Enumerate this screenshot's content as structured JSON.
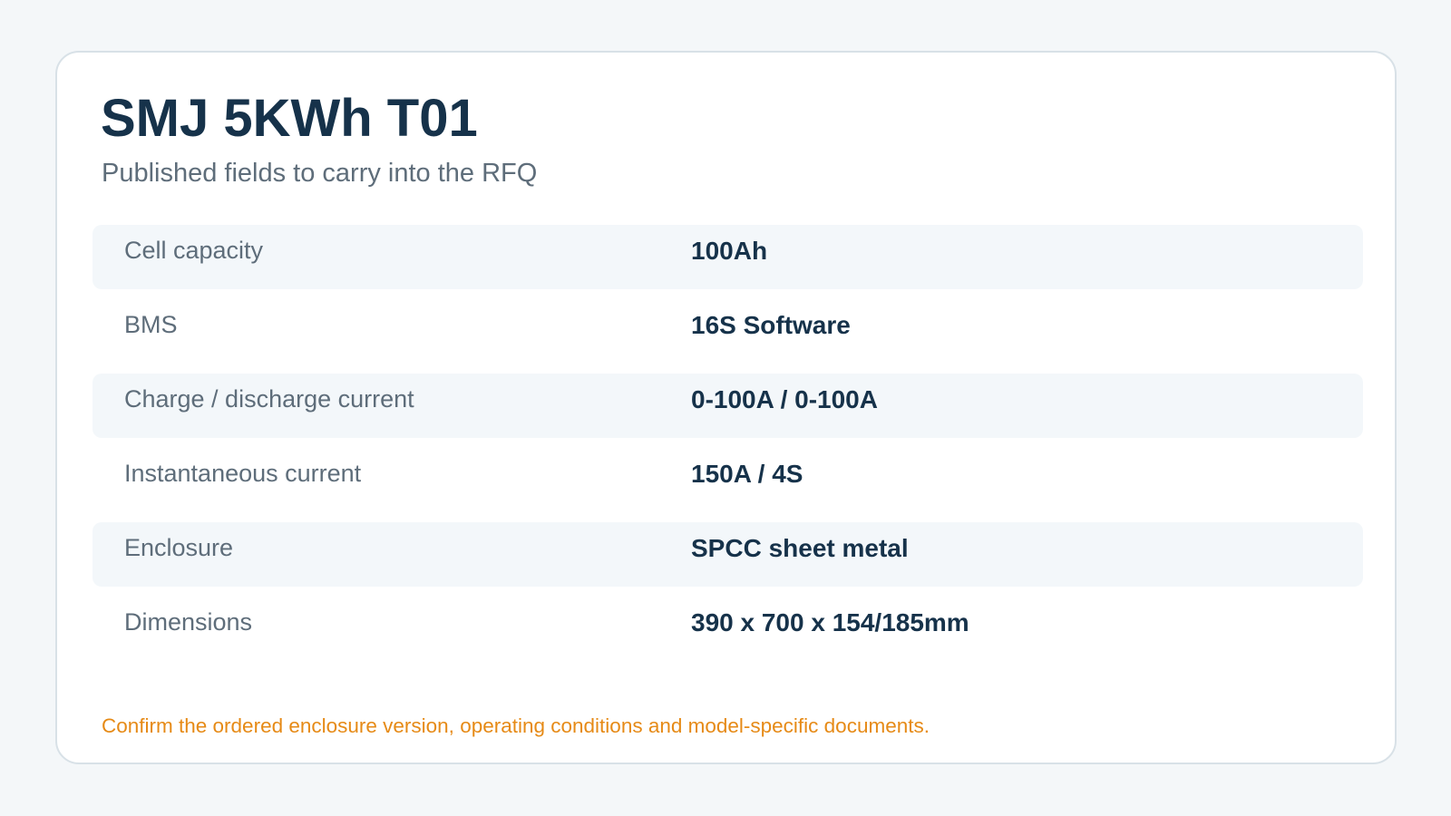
{
  "header": {
    "title": "SMJ 5KWh T01",
    "subtitle": "Published fields to carry into the RFQ"
  },
  "specs": [
    {
      "label": "Cell capacity",
      "value": "100Ah"
    },
    {
      "label": "BMS",
      "value": "16S Software"
    },
    {
      "label": "Charge / discharge current",
      "value": "0-100A / 0-100A"
    },
    {
      "label": "Instantaneous current",
      "value": "150A / 4S"
    },
    {
      "label": "Enclosure",
      "value": "SPCC sheet metal"
    },
    {
      "label": "Dimensions",
      "value": "390 x 700 x 154/185mm"
    }
  ],
  "note": "Confirm the ordered enclosure version, operating conditions and model-specific documents.",
  "colors": {
    "page_background": "#f4f7f9",
    "card_background": "#ffffff",
    "title": "#16324a",
    "muted_text": "#5e6d7a",
    "row_stripe": "#f3f7fa",
    "note_accent": "#e68a16"
  }
}
